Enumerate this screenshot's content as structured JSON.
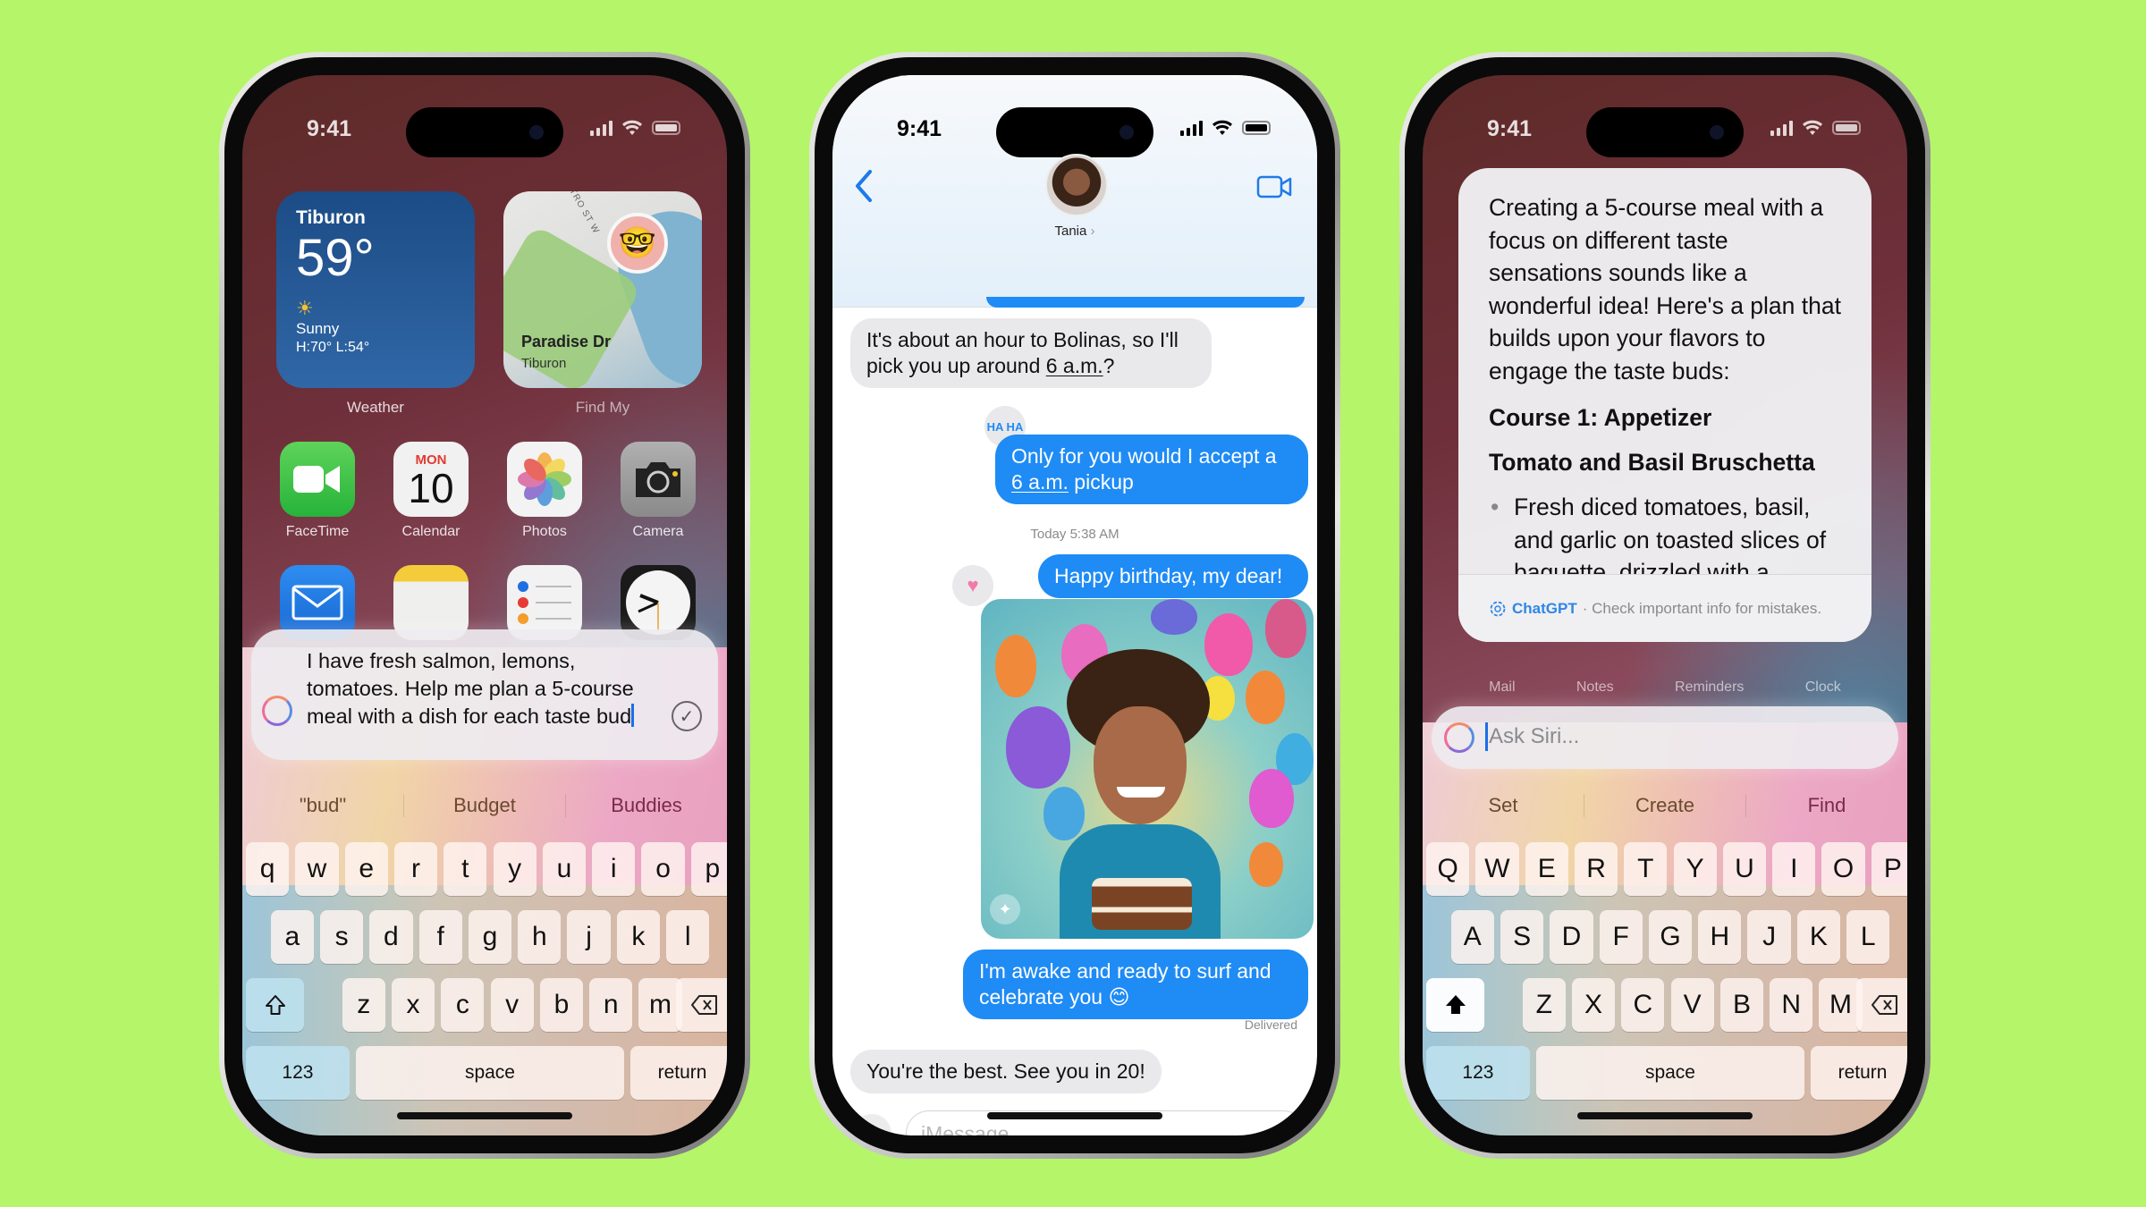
{
  "background_color": "#b4f56a",
  "accent_blue": "#1f8bf5",
  "phones": [
    {
      "id": "home-siri-typing",
      "status": {
        "time": "9:41"
      },
      "widgets": {
        "weather": {
          "city": "Tiburon",
          "temp": "59°",
          "condition": "Sunny",
          "hilo": "H:70° L:54°",
          "label": "Weather"
        },
        "findmy": {
          "street": "ENTRO ST W",
          "place": "Paradise Dr",
          "sub": "Tiburon",
          "label": "Find My"
        }
      },
      "apps": [
        {
          "label": "FaceTime",
          "icon": "facetime-icon"
        },
        {
          "label": "Calendar",
          "icon": "calendar-icon",
          "day": "MON",
          "date": "10"
        },
        {
          "label": "Photos",
          "icon": "photos-icon"
        },
        {
          "label": "Camera",
          "icon": "camera-icon"
        },
        {
          "label": "Mail",
          "icon": "mail-icon"
        },
        {
          "label": "Notes",
          "icon": "notes-icon"
        },
        {
          "label": "Reminders",
          "icon": "reminders-icon"
        },
        {
          "label": "Clock",
          "icon": "clock-icon"
        }
      ],
      "siri_input": {
        "value": "I have fresh salmon, lemons, tomatoes. Help me plan a 5-course meal with a dish for each taste bud"
      },
      "suggestions": [
        "\"bud\"",
        "Budget",
        "Buddies"
      ],
      "keyboard": {
        "row1": [
          "q",
          "w",
          "e",
          "r",
          "t",
          "y",
          "u",
          "i",
          "o",
          "p"
        ],
        "row2": [
          "a",
          "s",
          "d",
          "f",
          "g",
          "h",
          "j",
          "k",
          "l"
        ],
        "row3": [
          "z",
          "x",
          "c",
          "v",
          "b",
          "n",
          "m"
        ],
        "numbers": "123",
        "space": "space",
        "return": "return"
      }
    },
    {
      "id": "messages",
      "status": {
        "time": "9:41"
      },
      "contact": {
        "name": "Tania"
      },
      "messages": [
        {
          "dir": "in",
          "text": "It's about an hour to Bolinas, so I'll pick you up around 6 a.m.?"
        },
        {
          "dir": "out",
          "text_a": "Only for you would I accept a ",
          "text_link": "6 a.m.",
          "text_b": " pickup",
          "tapback": "HA HA"
        },
        {
          "type": "timestamp",
          "text": "Today 5:38 AM"
        },
        {
          "dir": "out",
          "text": "Happy birthday, my dear!",
          "tapback": "heart"
        },
        {
          "dir": "out",
          "type": "image",
          "alt": "Genmoji birthday image with balloons and cake"
        },
        {
          "dir": "out",
          "text": "I'm awake and ready to surf and celebrate you 😊"
        },
        {
          "type": "status",
          "text": "Delivered"
        },
        {
          "dir": "in",
          "text": "You're the best. See you in 20!"
        }
      ],
      "composer": {
        "placeholder": "iMessage"
      }
    },
    {
      "id": "siri-chatgpt",
      "status": {
        "time": "9:41"
      },
      "response": {
        "intro": "Creating a 5-course meal with a focus on different taste sensations sounds like a wonderful idea! Here's a plan that builds upon your flavors to engage the taste buds:",
        "course_heading": "Course 1: Appetizer",
        "dish": "Tomato and Basil Bruschetta",
        "bullet": "Fresh diced tomatoes, basil, and garlic on toasted slices of baguette, drizzled with a balsamic",
        "source": "ChatGPT",
        "disclaimer": "· Check important info for mistakes."
      },
      "dock_labels": [
        "Mail",
        "Notes",
        "Reminders",
        "Clock"
      ],
      "siri_input": {
        "placeholder": "Ask Siri..."
      },
      "suggestions": [
        "Set",
        "Create",
        "Find"
      ],
      "keyboard": {
        "row1": [
          "Q",
          "W",
          "E",
          "R",
          "T",
          "Y",
          "U",
          "I",
          "O",
          "P"
        ],
        "row2": [
          "A",
          "S",
          "D",
          "F",
          "G",
          "H",
          "J",
          "K",
          "L"
        ],
        "row3": [
          "Z",
          "X",
          "C",
          "V",
          "B",
          "N",
          "M"
        ],
        "numbers": "123",
        "space": "space",
        "return": "return"
      }
    }
  ]
}
